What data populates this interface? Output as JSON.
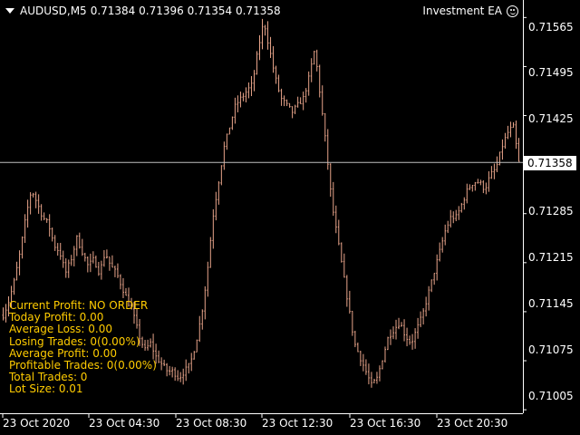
{
  "header": {
    "symbol": "AUDUSD,M5",
    "ohlc": "0.71384 0.71396 0.71354 0.71358",
    "ea_name": "Investment EA",
    "ea_icon": "smiley-icon"
  },
  "current_price": "0.71358",
  "price_axis": [
    "0.71565",
    "0.71495",
    "0.71425",
    "0.71358",
    "0.71285",
    "0.71215",
    "0.71145",
    "0.71075",
    "0.71005"
  ],
  "time_axis": [
    "23 Oct 2020",
    "23 Oct 04:30",
    "23 Oct 08:30",
    "23 Oct 12:30",
    "23 Oct 16:30",
    "23 Oct 20:30"
  ],
  "info_panel": {
    "current_profit": "Current Profit: NO ORDER",
    "today_profit": "Today Profit: 0.00",
    "average_loss": "Average Loss: 0.00",
    "losing_trades": "Losing  Trades: 0(0.00%)",
    "average_profit": "Average Profit: 0.00",
    "profitable_trades": "Profitable Trades: 0(0.00%)",
    "total_trades": "Total Trades: 0",
    "lot_size": "Lot Size: 0.01"
  },
  "colors": {
    "background": "#000000",
    "bars": "#e8a48a",
    "axis": "#ffffff",
    "price_line": "#c0c0c0",
    "info_text": "#ffcc00"
  },
  "chart_data": {
    "type": "bar",
    "symbol": "AUDUSD",
    "timeframe": "M5",
    "ylim": [
      0.71,
      0.7159
    ],
    "yticks": [
      0.71565,
      0.71495,
      0.71425,
      0.71285,
      0.71215,
      0.71145,
      0.71075,
      0.71005
    ],
    "last_close": 0.71358,
    "closes": [
      0.7114,
      0.7116,
      0.7119,
      0.7123,
      0.7128,
      0.7132,
      0.713,
      0.7128,
      0.7127,
      0.7124,
      0.7123,
      0.712,
      0.7122,
      0.7125,
      0.7123,
      0.7121,
      0.7122,
      0.712,
      0.7123,
      0.7121,
      0.712,
      0.7118,
      0.7116,
      0.7114,
      0.7111,
      0.7109,
      0.711,
      0.7108,
      0.7107,
      0.7106,
      0.7106,
      0.7105,
      0.7106,
      0.7107,
      0.711,
      0.7114,
      0.712,
      0.7128,
      0.7133,
      0.7138,
      0.7141,
      0.7144,
      0.7145,
      0.7146,
      0.7147,
      0.7152,
      0.7156,
      0.7152,
      0.7148,
      0.7145,
      0.7144,
      0.7143,
      0.7144,
      0.7145,
      0.7148,
      0.7152,
      0.7145,
      0.7138,
      0.713,
      0.7125,
      0.712,
      0.7115,
      0.711,
      0.7108,
      0.7106,
      0.7104,
      0.7105,
      0.7108,
      0.7111,
      0.7112,
      0.7113,
      0.7111,
      0.711,
      0.7112,
      0.7114,
      0.7117,
      0.712,
      0.7123,
      0.7126,
      0.7128,
      0.7128,
      0.713,
      0.7132,
      0.7133,
      0.7133,
      0.7132,
      0.7134,
      0.7135,
      0.7138,
      0.714,
      0.7141,
      0.71358
    ]
  }
}
